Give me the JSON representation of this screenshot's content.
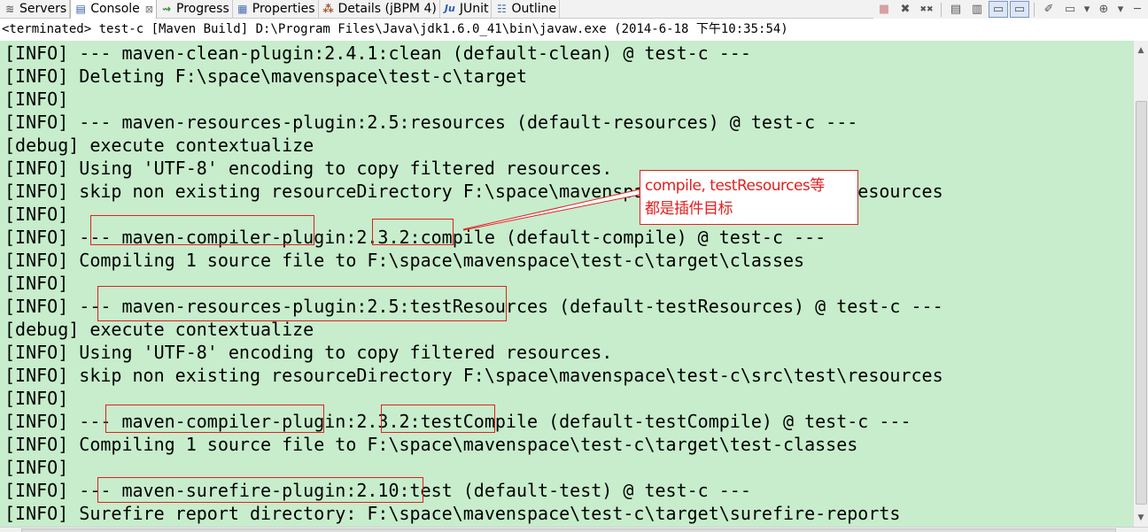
{
  "tabs": [
    {
      "label": "Servers",
      "icon": "servers-icon",
      "glyph": "≋"
    },
    {
      "label": "Console",
      "icon": "console-icon",
      "glyph": "▤",
      "active": true,
      "close": "⊠"
    },
    {
      "label": "Progress",
      "icon": "progress-icon",
      "glyph": "⇝"
    },
    {
      "label": "Properties",
      "icon": "properties-icon",
      "glyph": "▦"
    },
    {
      "label": "Details (jBPM 4)",
      "icon": "details-icon",
      "glyph": "⁂"
    },
    {
      "label": "JUnit",
      "icon": "junit-icon",
      "glyph": "Ju"
    },
    {
      "label": "Outline",
      "icon": "outline-icon",
      "glyph": "☷"
    }
  ],
  "toolbar": {
    "terminate": "■",
    "remove_launch": "✖",
    "remove_all": "✖✖",
    "clear_console": "▤",
    "scroll_lock": "▥",
    "show_stdout": "▭",
    "show_stderr": "▭",
    "pin_console": "✐",
    "display_selected": "▭",
    "dropdown1": "▾",
    "open_console": "⊕",
    "dropdown2": "▾",
    "minimize": "─"
  },
  "status": "<terminated> test-c [Maven Build] D:\\Program Files\\Java\\jdk1.6.0_41\\bin\\javaw.exe (2014-6-18 下午10:35:54)",
  "console_lines": [
    "[INFO] --- maven-clean-plugin:2.4.1:clean (default-clean) @ test-c ---",
    "[INFO] Deleting F:\\space\\mavenspace\\test-c\\target",
    "[INFO]",
    "[INFO] --- maven-resources-plugin:2.5:resources (default-resources) @ test-c ---",
    "[debug] execute contextualize",
    "[INFO] Using 'UTF-8' encoding to copy filtered resources.",
    "[INFO] skip non existing resourceDirectory F:\\space\\mavenspace\\test-c\\src\\main\\resources",
    "[INFO]",
    "[INFO] --- maven-compiler-plugin:2.3.2:compile (default-compile) @ test-c ---",
    "[INFO] Compiling 1 source file to F:\\space\\mavenspace\\test-c\\target\\classes",
    "[INFO]",
    "[INFO] --- maven-resources-plugin:2.5:testResources (default-testResources) @ test-c ---",
    "[debug] execute contextualize",
    "[INFO] Using 'UTF-8' encoding to copy filtered resources.",
    "[INFO] skip non existing resourceDirectory F:\\space\\mavenspace\\test-c\\src\\test\\resources",
    "[INFO]",
    "[INFO] --- maven-compiler-plugin:2.3.2:testCompile (default-testCompile) @ test-c ---",
    "[INFO] Compiling 1 source file to F:\\space\\mavenspace\\test-c\\target\\test-classes",
    "[INFO]",
    "[INFO] --- maven-surefire-plugin:2.10:test (default-test) @ test-c ---",
    "[INFO] Surefire report directory: F:\\space\\mavenspace\\test-c\\target\\surefire-reports"
  ],
  "callout": {
    "line1": "compile, testResources等",
    "line2": "都是插件目标"
  },
  "colors": {
    "console_bg": "#c7edcc",
    "annotation_red": "#e0201f"
  }
}
